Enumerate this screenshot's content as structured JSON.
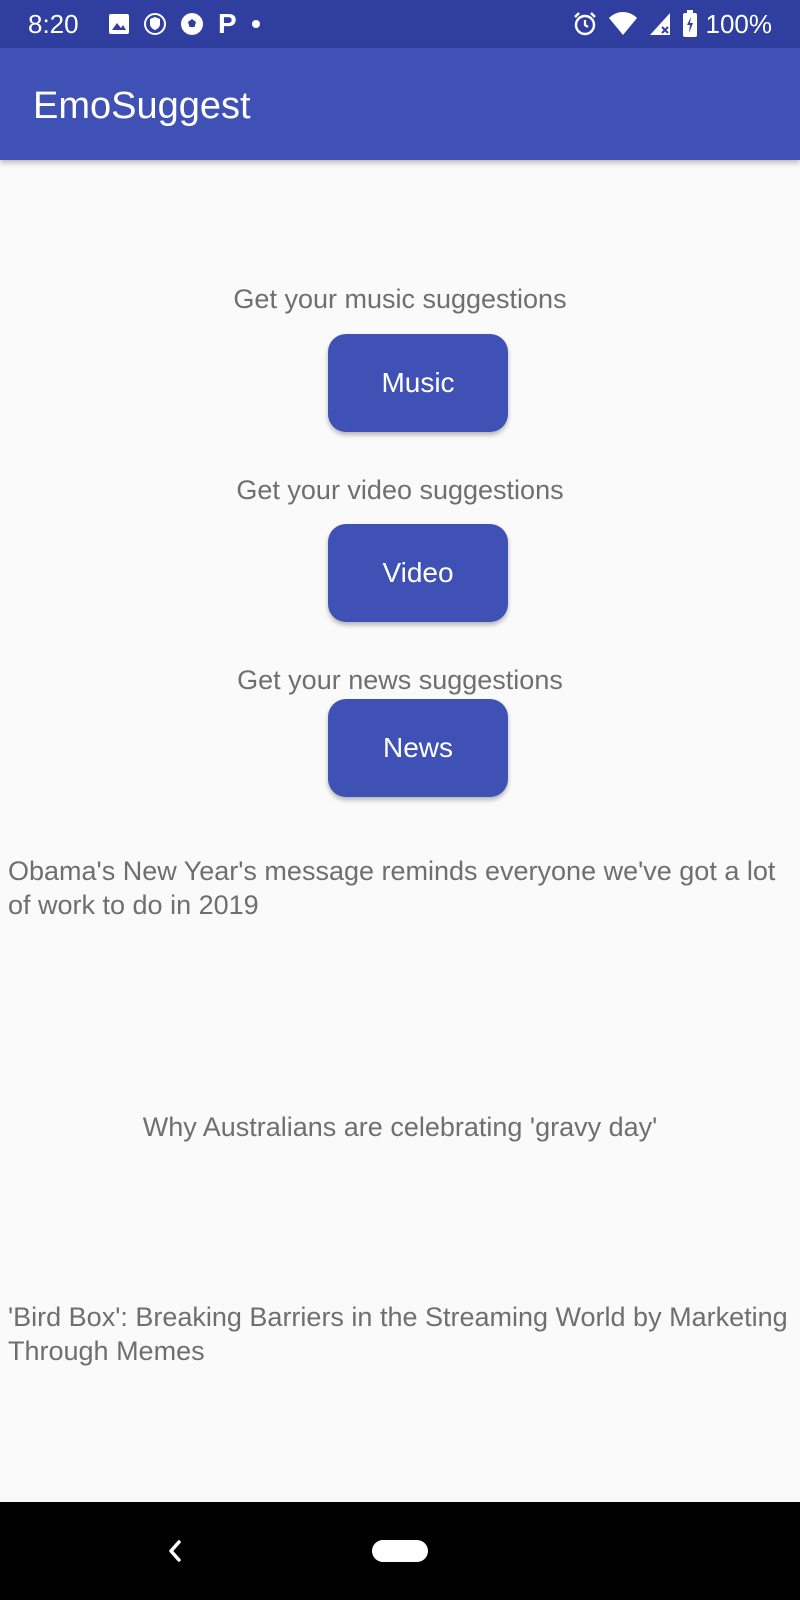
{
  "status_bar": {
    "time": "8:20",
    "battery": "100%",
    "left_icons": [
      "image-icon",
      "shield-icon",
      "soccer-ball-icon",
      "p-icon",
      "dot-icon"
    ],
    "right_icons": [
      "alarm-icon",
      "wifi-icon",
      "signal-icon",
      "battery-icon"
    ],
    "p_glyph": "P"
  },
  "app_bar": {
    "title": "EmoSuggest",
    "color": "#3f51b5"
  },
  "sections": [
    {
      "caption": "Get your music suggestions",
      "button_label": "Music"
    },
    {
      "caption": "Get your video suggestions",
      "button_label": "Video"
    },
    {
      "caption": "Get your news suggestions",
      "button_label": "News"
    }
  ],
  "news": [
    "Obama's New Year's message reminds everyone we've got a lot of work to do in 2019",
    "Why Australians are celebrating 'gravy day'",
    "'Bird Box': Breaking Barriers in the Streaming World by Marketing Through Memes"
  ],
  "nav_bar": {
    "icons": [
      "back-icon",
      "home-pill-icon"
    ]
  }
}
